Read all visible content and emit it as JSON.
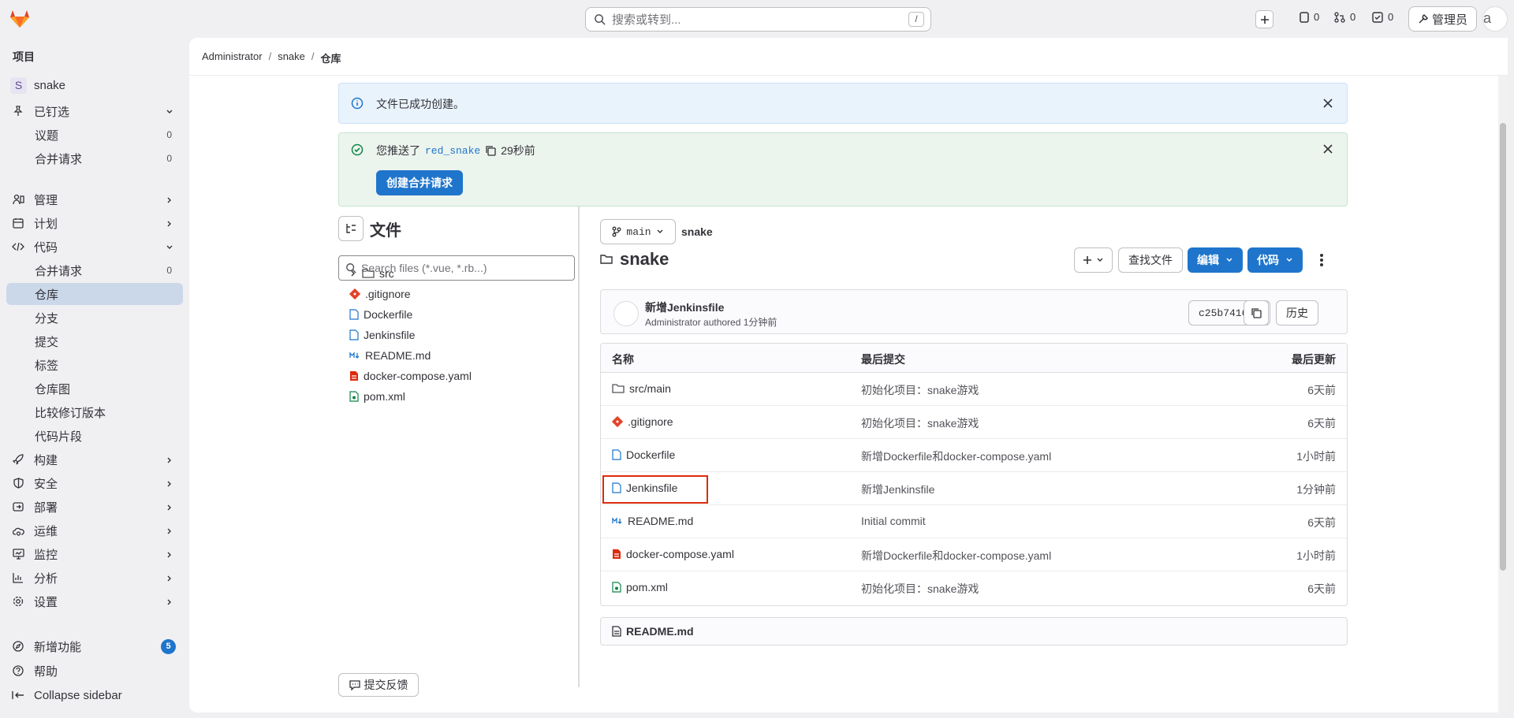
{
  "search": {
    "placeholder": "搜索或转到...",
    "shortcut": "/"
  },
  "topbar": {
    "issues_count": "0",
    "mr_count": "0",
    "todo_count": "0",
    "admin_label": "管理员",
    "avatar_alt": "a"
  },
  "sidebar": {
    "heading": "项目",
    "project": {
      "initial": "S",
      "name": "snake"
    },
    "pinned": {
      "label": "已钉选",
      "items": [
        {
          "label": "议题",
          "count": "0"
        },
        {
          "label": "合并请求",
          "count": "0"
        }
      ]
    },
    "sections": [
      "管理",
      "计划",
      "代码"
    ],
    "code_items": [
      {
        "label": "合并请求",
        "count": "0"
      },
      {
        "label": "仓库"
      },
      {
        "label": "分支"
      },
      {
        "label": "提交"
      },
      {
        "label": "标签"
      },
      {
        "label": "仓库图"
      },
      {
        "label": "比较修订版本"
      },
      {
        "label": "代码片段"
      }
    ],
    "more_sections": [
      "构建",
      "安全",
      "部署",
      "运维",
      "监控",
      "分析",
      "设置"
    ],
    "whats_new": {
      "label": "新增功能",
      "count": "5"
    },
    "help": "帮助",
    "collapse": "Collapse sidebar"
  },
  "breadcrumb": [
    "Administrator",
    "snake",
    "仓库"
  ],
  "alerts": {
    "info": "文件已成功创建。",
    "push_prefix": "您推送了",
    "push_branch": "red_snake",
    "push_time": "29秒前",
    "create_mr": "创建合并请求"
  },
  "tree": {
    "title": "文件",
    "search_placeholder": "Search files (*.vue, *.rb...)",
    "items": [
      "src",
      ".gitignore",
      "Dockerfile",
      "Jenkinsfile",
      "README.md",
      "docker-compose.yaml",
      "pom.xml"
    ],
    "feedback": "提交反馈"
  },
  "repo": {
    "branch": "main",
    "name": "snake",
    "folder_title": "snake",
    "find_file": "查找文件",
    "edit": "编辑",
    "code": "代码",
    "last_commit": {
      "title": "新增Jenkinsfile",
      "author_line": "Administrator authored 1分钟前",
      "sha": "c25b7416",
      "history": "历史"
    },
    "table": {
      "headers": [
        "名称",
        "最后提交",
        "最后更新"
      ],
      "rows": [
        {
          "name": "src/main",
          "commit": "初始化项目：snake游戏",
          "updated": "6天前"
        },
        {
          "name": ".gitignore",
          "commit": "初始化项目：snake游戏",
          "updated": "6天前"
        },
        {
          "name": "Dockerfile",
          "commit": "新增Dockerfile和docker-compose.yaml",
          "updated": "1小时前"
        },
        {
          "name": "Jenkinsfile",
          "commit": "新增Jenkinsfile",
          "updated": "1分钟前"
        },
        {
          "name": "README.md",
          "commit": "Initial commit",
          "updated": "6天前"
        },
        {
          "name": "docker-compose.yaml",
          "commit": "新增Dockerfile和docker-compose.yaml",
          "updated": "1小时前"
        },
        {
          "name": "pom.xml",
          "commit": "初始化项目：snake游戏",
          "updated": "6天前"
        }
      ]
    },
    "readme": "README.md"
  }
}
